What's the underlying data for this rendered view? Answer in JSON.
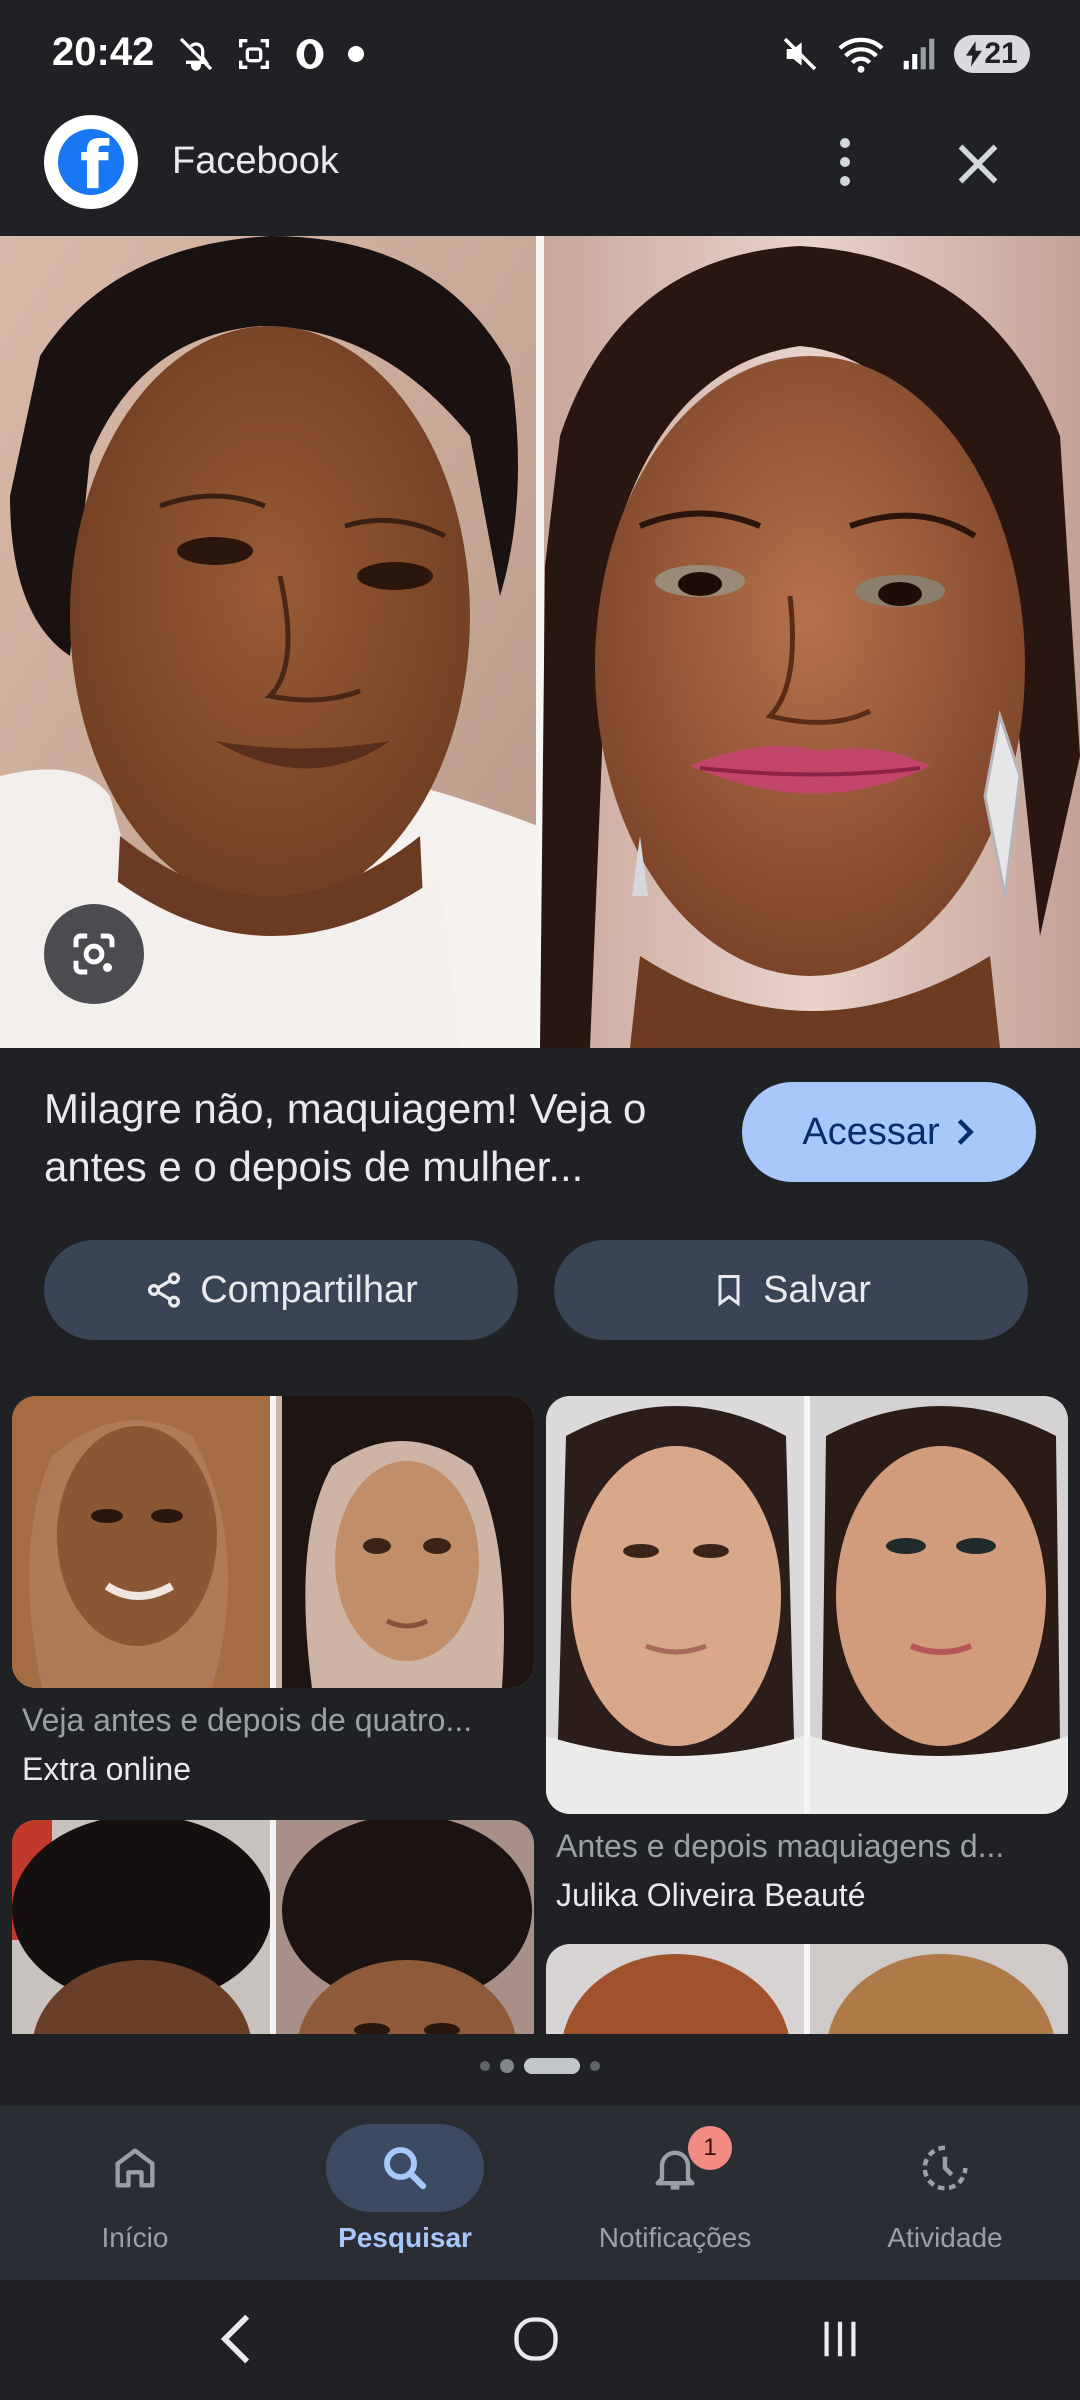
{
  "status_bar": {
    "time": "20:42",
    "battery": "21",
    "icons": [
      "notifications-off-icon",
      "screenshot-icon",
      "opera-icon",
      "dot-icon",
      "mute-icon",
      "wifi-icon",
      "signal-icon",
      "battery-charging-icon"
    ]
  },
  "header": {
    "site_name": "Facebook",
    "logo": "facebook-logo",
    "icons": [
      "more-vert-icon",
      "close-icon"
    ]
  },
  "main_image": {
    "alt": "Before and after makeup comparison",
    "lens_icon": "google-lens-icon"
  },
  "result": {
    "title": "Milagre não, maquiagem! Veja o antes e o depois de mulher...",
    "visit_label": "Acessar",
    "share_label": "Compartilhar",
    "save_label": "Salvar"
  },
  "related": [
    {
      "title": "Veja antes e depois de quatro...",
      "source": "Extra online"
    },
    {
      "title": "Antes e depois maquiagens d...",
      "source": "Julika Oliveira Beauté"
    }
  ],
  "bottom_nav": {
    "items": [
      {
        "label": "Início",
        "icon": "home-icon"
      },
      {
        "label": "Pesquisar",
        "icon": "search-icon"
      },
      {
        "label": "Notificações",
        "icon": "bell-icon",
        "badge": "1"
      },
      {
        "label": "Atividade",
        "icon": "activity-icon"
      }
    ],
    "active_index": 1
  },
  "system_nav": {
    "icons": [
      "back-icon",
      "home-circle-icon",
      "recents-icon"
    ]
  },
  "colors": {
    "background": "#1f2125",
    "accent": "#a8c7fa",
    "button_dark": "#394457",
    "nav_bg": "#2a2d34"
  }
}
